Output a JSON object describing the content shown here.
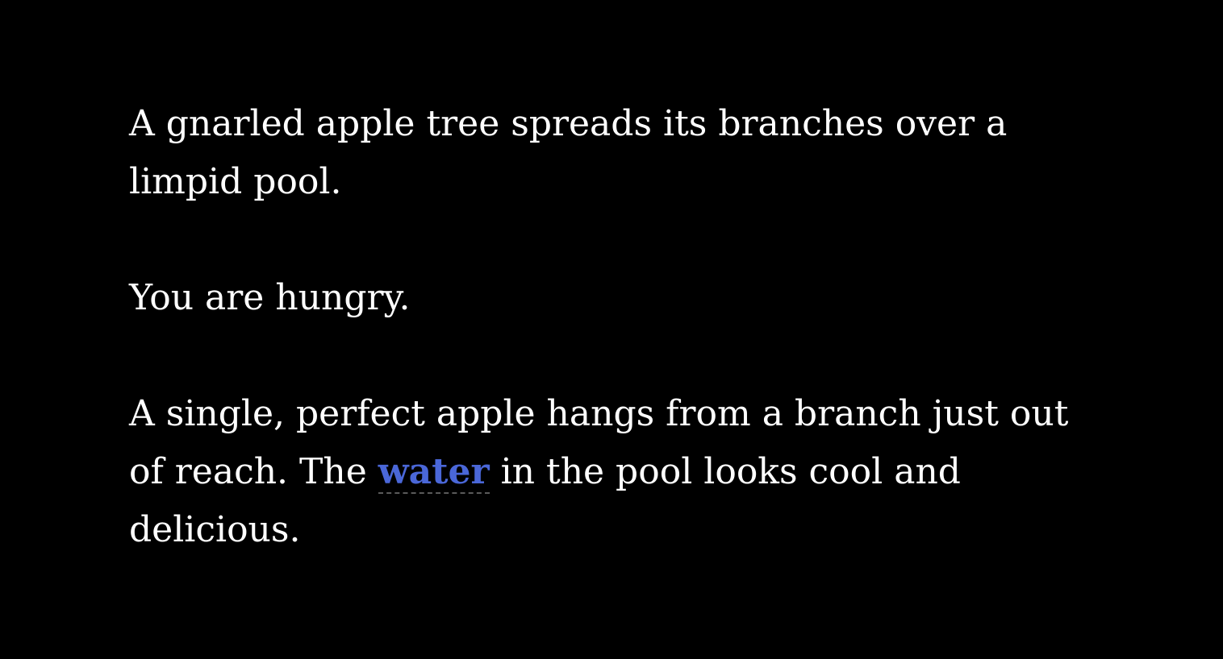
{
  "passage": {
    "p1": "A gnarled apple tree spreads its branches over a limpid pool.",
    "p2": "You are hungry.",
    "p3_before": "A single, perfect apple hangs from a branch just out of reach. The ",
    "p3_link": "water",
    "p3_after": " in the pool looks cool and delicious."
  },
  "colors": {
    "background": "#000000",
    "text": "#ffffff",
    "link": "#4a67d8"
  }
}
